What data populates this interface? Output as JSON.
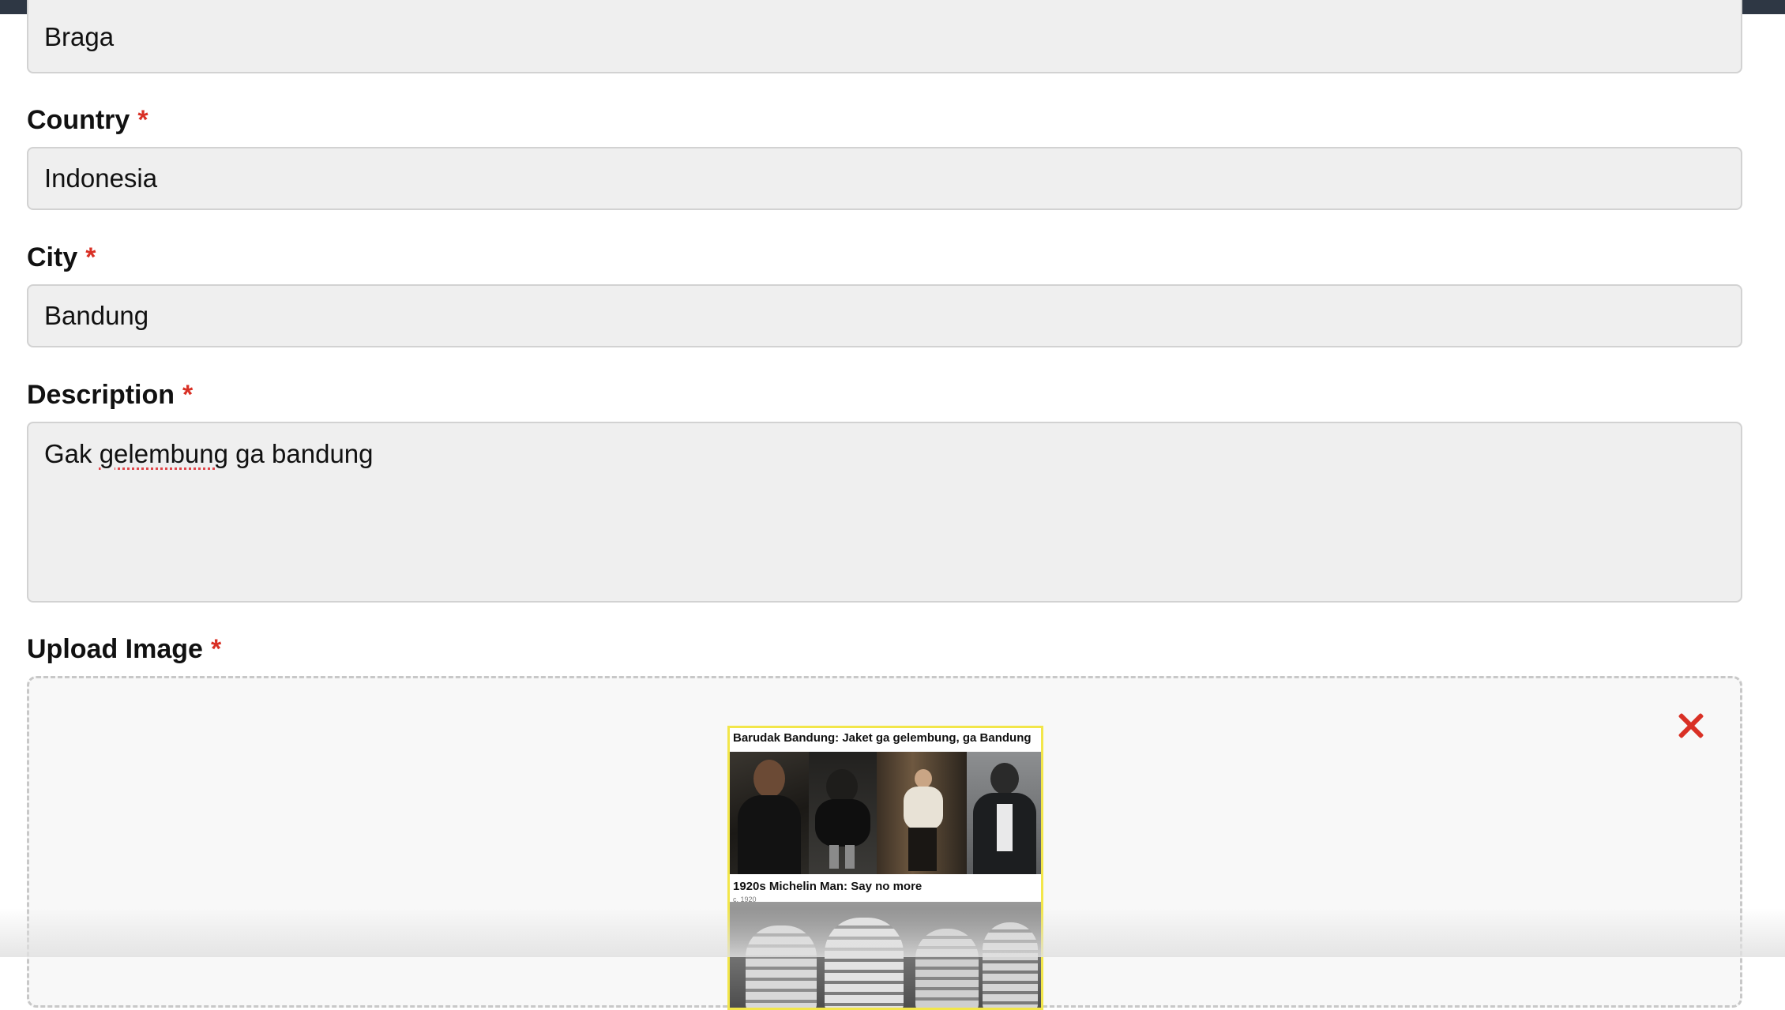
{
  "form": {
    "street": {
      "value": "Braga"
    },
    "country": {
      "label": "Country",
      "required_mark": "*",
      "value": "Indonesia"
    },
    "city": {
      "label": "City",
      "required_mark": "*",
      "value": "Bandung"
    },
    "description": {
      "label": "Description",
      "required_mark": "*",
      "value_before": "Gak ",
      "value_misspelled": "gelembung",
      "value_after": " ga bandung"
    },
    "upload": {
      "label": "Upload Image",
      "required_mark": "*",
      "remove_icon": "close-icon",
      "preview": {
        "caption_top": "Barudak Bandung: Jaket ga gelembung, ga Bandung",
        "caption_bottom": "1920s Michelin Man: Say no more",
        "caption_small": "c. 1920"
      }
    }
  },
  "colors": {
    "topbar": "#2e3744",
    "required": "#d93025",
    "input_bg": "#efefef",
    "preview_border": "#f2e64a"
  }
}
